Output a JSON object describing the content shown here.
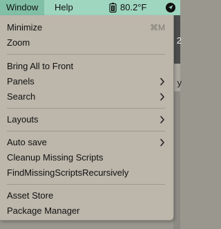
{
  "menubar": {
    "window_label": "Window",
    "help_label": "Help",
    "temperature": "80.2°F",
    "icons": {
      "temp": "thermometer-battery-icon",
      "location": "location-arrow-icon"
    }
  },
  "background": {
    "peek_1": "2",
    "peek_2": "y"
  },
  "menu": {
    "minimize": "Minimize",
    "minimize_shortcut": "⌘M",
    "zoom": "Zoom",
    "bring_all": "Bring All to Front",
    "panels": "Panels",
    "search": "Search",
    "layouts": "Layouts",
    "auto_save": "Auto save",
    "cleanup": "Cleanup Missing Scripts",
    "find_missing": "FindMissingScriptsRecursively",
    "asset_store": "Asset Store",
    "package_manager": "Package Manager"
  }
}
